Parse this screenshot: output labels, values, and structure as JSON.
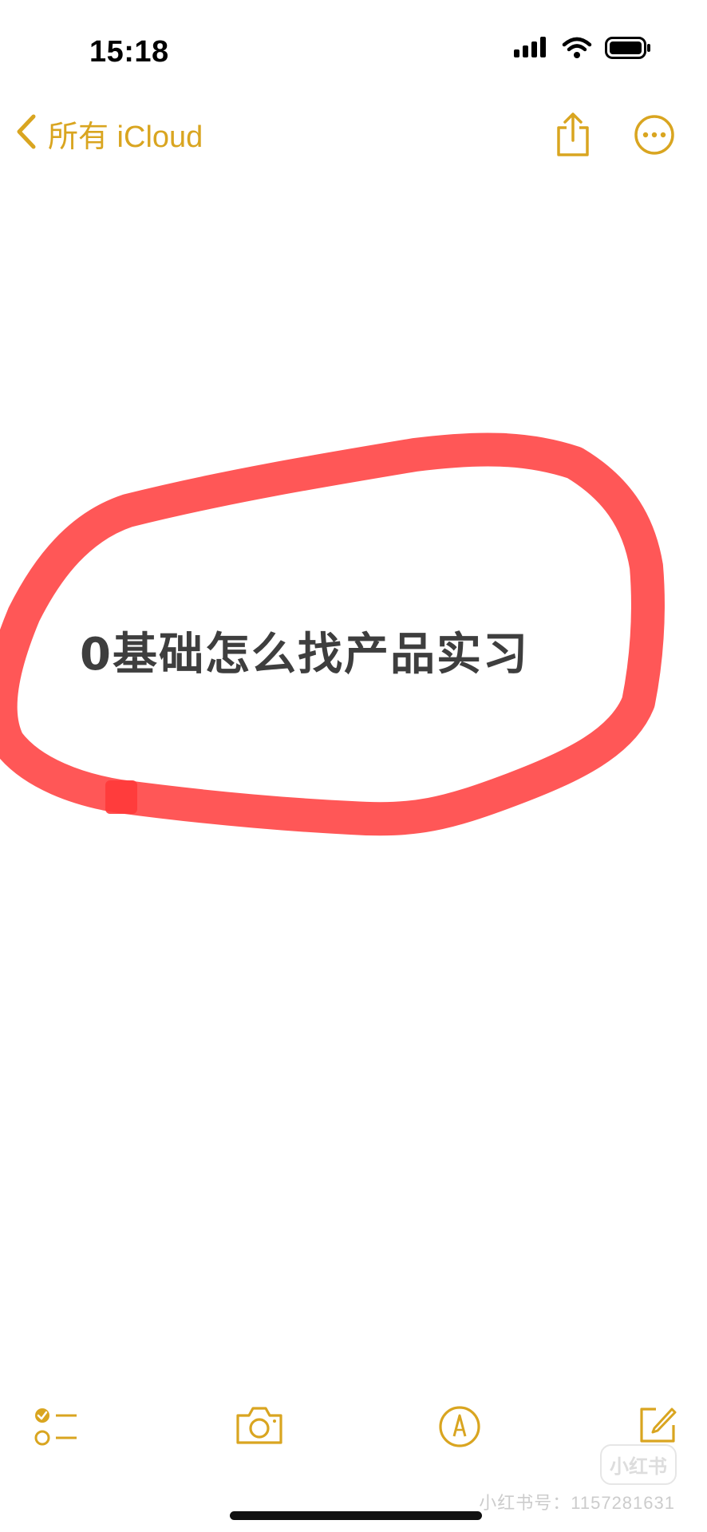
{
  "status": {
    "time": "15:18",
    "icons": [
      "cellular-signal-icon",
      "wifi-icon",
      "battery-icon"
    ]
  },
  "nav": {
    "back_label": "所有 iCloud",
    "icons": [
      "chevron-left-icon",
      "share-icon",
      "more-icon"
    ]
  },
  "note": {
    "text": "0基础怎么找产品实习",
    "annotation_color": "#ff4040"
  },
  "toolbar": {
    "icons": [
      "checklist-icon",
      "camera-icon",
      "markup-pen-icon",
      "compose-icon"
    ]
  },
  "watermark": {
    "logo": "小红书",
    "id_text": "小红书号：1157281631"
  },
  "colors": {
    "accent": "#d9a520",
    "text": "#3e3e3e",
    "background": "#ffffff"
  }
}
